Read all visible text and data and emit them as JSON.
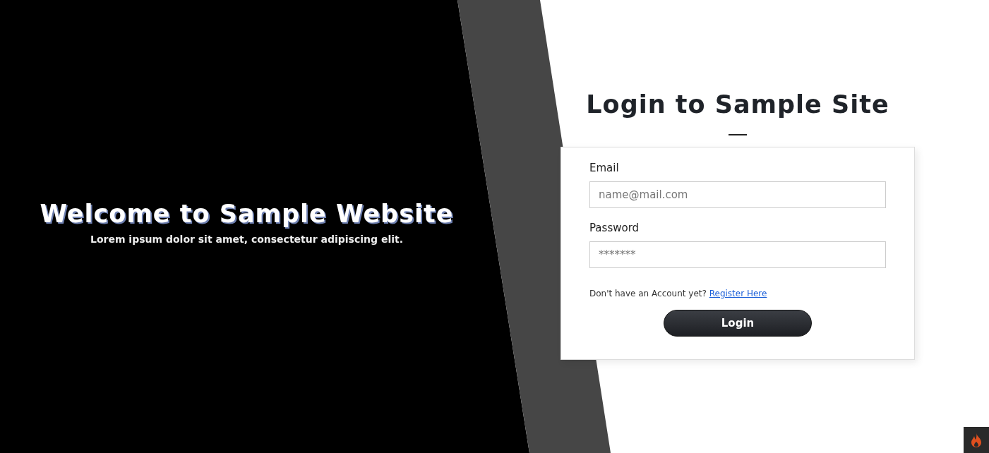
{
  "hero": {
    "title": "Welcome to Sample Website",
    "subtitle": "Lorem ipsum dolor sit amet, consectetur adipiscing elit."
  },
  "login": {
    "title": "Login to Sample Site",
    "fields": [
      {
        "label": "Email",
        "placeholder": "name@mail.com"
      },
      {
        "label": "Password",
        "placeholder": "*******"
      }
    ],
    "register_prompt": "Don't have an Account yet?",
    "register_link": "Register Here",
    "button": "Login"
  }
}
